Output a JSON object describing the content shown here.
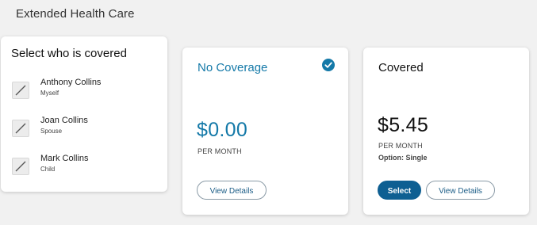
{
  "section": {
    "title": "Extended Health Care"
  },
  "coverage_selector": {
    "title": "Select who is covered",
    "people": [
      {
        "name": "Anthony Collins",
        "relation": "Myself",
        "checked": false
      },
      {
        "name": "Joan Collins",
        "relation": "Spouse",
        "checked": false
      },
      {
        "name": "Mark Collins",
        "relation": "Child",
        "checked": false
      }
    ]
  },
  "plans": [
    {
      "name": "No Coverage",
      "price": "$0.00",
      "period": "PER MONTH",
      "selected": true,
      "view_details_label": "View Details"
    },
    {
      "name": "Covered",
      "price": "$5.45",
      "period": "PER MONTH",
      "option": "Option: Single",
      "selected": false,
      "select_label": "Select",
      "view_details_label": "View Details"
    }
  ],
  "colors": {
    "accent": "#1479a8",
    "primary_button": "#0e5f92",
    "background": "#f1f1f1"
  }
}
